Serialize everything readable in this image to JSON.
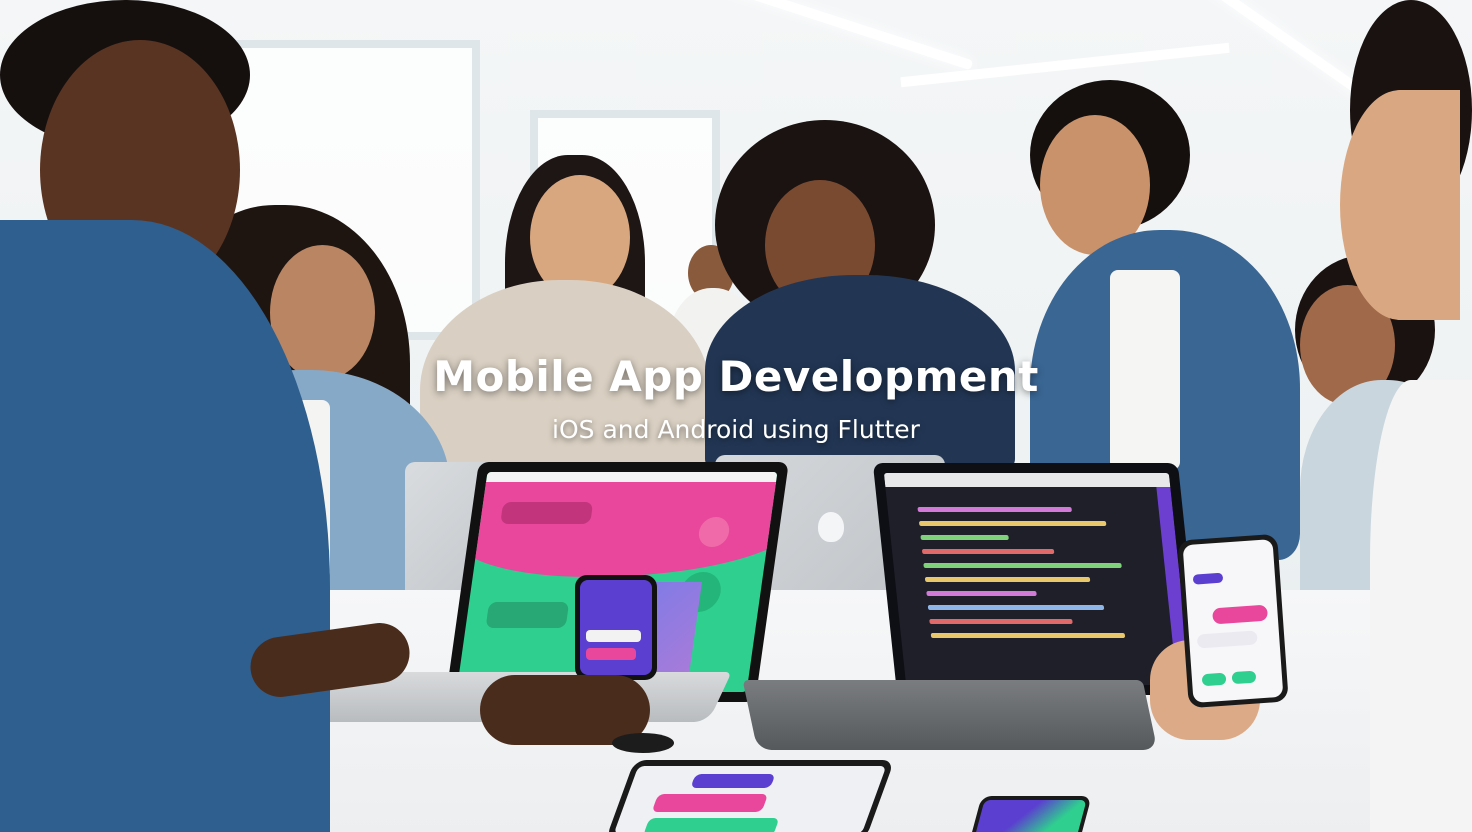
{
  "banner": {
    "title": "Mobile App Development",
    "subtitle": "iOS and Android using Flutter"
  },
  "scene": {
    "description_icons": {
      "apple_logo": "apple-logo-icon",
      "phone": "smartphone-icon",
      "laptop": "laptop-icon"
    },
    "colors": {
      "app_pink": "#e9479b",
      "app_green": "#2fcf8f",
      "app_purple": "#5b3fd0",
      "code_bg": "#1e1f29",
      "denim": "#2f5f8f"
    }
  }
}
